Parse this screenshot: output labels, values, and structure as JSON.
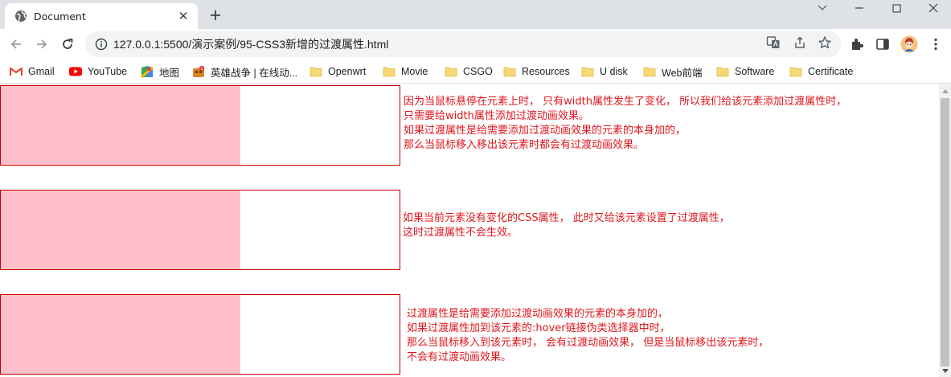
{
  "tab": {
    "title": "Document",
    "close": "✕",
    "new_tab": "+"
  },
  "address_bar": {
    "url": "127.0.0.1:5500/演示案例/95-CSS3新增的过渡属性.html"
  },
  "bookmarks": [
    {
      "label": "Gmail",
      "icon": "gmail-icon"
    },
    {
      "label": "YouTube",
      "icon": "youtube-icon"
    },
    {
      "label": "地图",
      "icon": "maps-icon"
    },
    {
      "label": "英雄战争 | 在线动...",
      "icon": "game-icon"
    },
    {
      "label": "Openwrt",
      "icon": "folder-icon"
    },
    {
      "label": "Movie",
      "icon": "folder-icon"
    },
    {
      "label": "CSGO",
      "icon": "folder-icon"
    },
    {
      "label": "Resources",
      "icon": "folder-icon"
    },
    {
      "label": "U disk",
      "icon": "folder-icon"
    },
    {
      "label": "Web前端",
      "icon": "folder-icon"
    },
    {
      "label": "Software",
      "icon": "folder-icon"
    },
    {
      "label": "Certificate",
      "icon": "folder-icon"
    }
  ],
  "demos": [
    {
      "fill_fraction": 0.6,
      "lines": [
        "因为当鼠标悬停在元素上时， 只有width属性发生了变化， 所以我们给该元素添加过渡属性时，",
        "只需要给width属性添加过渡动画效果。",
        "如果过渡属性是给需要添加过渡动画效果的元素的本身加的，",
        "那么当鼠标移入移出该元素时都会有过渡动画效果。"
      ]
    },
    {
      "fill_fraction": 0.6,
      "lines": [
        "如果当前元素没有变化的CSS属性， 此时又给该元素设置了过渡属性，",
        "这时过渡属性不会生效。"
      ]
    },
    {
      "fill_fraction": 0.6,
      "lines": [
        "过渡属性是给需要添加过渡动画效果的元素的本身加的，",
        "如果过渡属性加到该元素的:hover链接伪类选择器中时，",
        "那么当鼠标移入到该元素时， 会有过渡动画效果， 但是当鼠标移出该元素时，",
        "不会有过渡动画效果。"
      ]
    }
  ],
  "colors": {
    "box_border": "#c00000",
    "box_fill": "#ffc0cb",
    "text": "#e0161d"
  }
}
